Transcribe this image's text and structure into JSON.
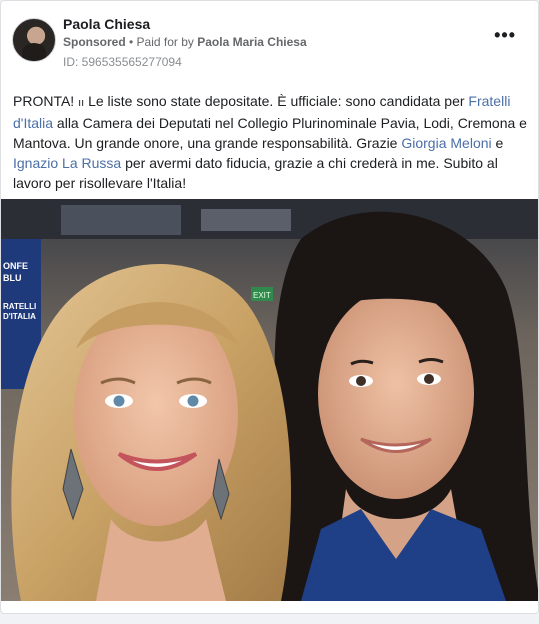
{
  "post": {
    "author_name": "Paola Chiesa",
    "sponsored_label": "Sponsored",
    "separator": " • ",
    "paid_for_prefix": "Paid for by ",
    "paid_for_name": "Paola Maria Chiesa",
    "ad_id": "ID: 596535565277094",
    "more_options": "•••"
  },
  "body_text": {
    "part1": "PRONTA! ",
    "flag_glyph": "ıı",
    "part2": " Le liste sono state depositate. È ufficiale: sono candidata per ",
    "link1": "Fratelli d'Italia",
    "part3": " alla Camera dei Deputati nel Collegio Plurinominale Pavia, Lodi, Cremona e Mantova. Un grande onore, una grande responsabilità. Grazie ",
    "link2": "Giorgia Meloni",
    "part4": " e ",
    "link3": "Ignazio La Russa",
    "part5": " per avermi dato fiducia, grazie a chi crederà in me. Subito al lavoro per risollevare l'Italia!"
  },
  "photo": {
    "background_sign_lines": [
      "ONFE",
      "BLU",
      "RATELLI",
      "D'ITALIA"
    ],
    "exit_sign": "EXIT"
  },
  "colors": {
    "link": "#4b6fa7",
    "text": "#1c1e21",
    "meta": "#65676b"
  }
}
